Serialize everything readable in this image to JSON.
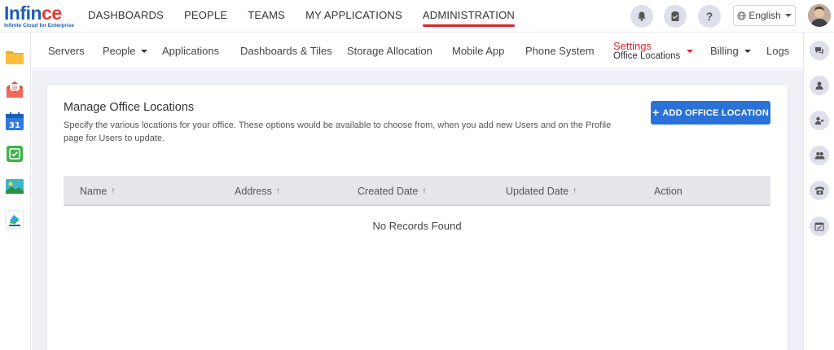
{
  "brand": {
    "name_part1": "Inf",
    "name_part2": "in",
    "name_part3": "ce",
    "tagline": "Infinite Cloud for Enterprise"
  },
  "topnav": {
    "items": [
      {
        "label": "DASHBOARDS"
      },
      {
        "label": "PEOPLE"
      },
      {
        "label": "TEAMS"
      },
      {
        "label": "MY APPLICATIONS"
      },
      {
        "label": "ADMINISTRATION",
        "active": true
      }
    ],
    "language": "English"
  },
  "subnav": {
    "servers": "Servers",
    "people": "People",
    "applications": "Applications",
    "dashboards": "Dashboards & Tiles",
    "storage": "Storage Allocation",
    "mobile": "Mobile App",
    "phone": "Phone System",
    "settings": "Settings",
    "settings_sub": "Office Locations",
    "billing": "Billing",
    "logs": "Logs"
  },
  "page": {
    "title": "Manage Office Locations",
    "description": "Specify the various locations for your office. These options would be available to choose from, when you add new Users and on the Profile page for Users to update.",
    "add_button": "ADD OFFICE LOCATION"
  },
  "table": {
    "columns": [
      "Name",
      "Address",
      "Created Date",
      "Updated Date",
      "Action"
    ],
    "empty_text": "No Records Found"
  },
  "colors": {
    "accent": "#2a72d7",
    "active": "#d9232d",
    "brand": "#1d5db5"
  }
}
